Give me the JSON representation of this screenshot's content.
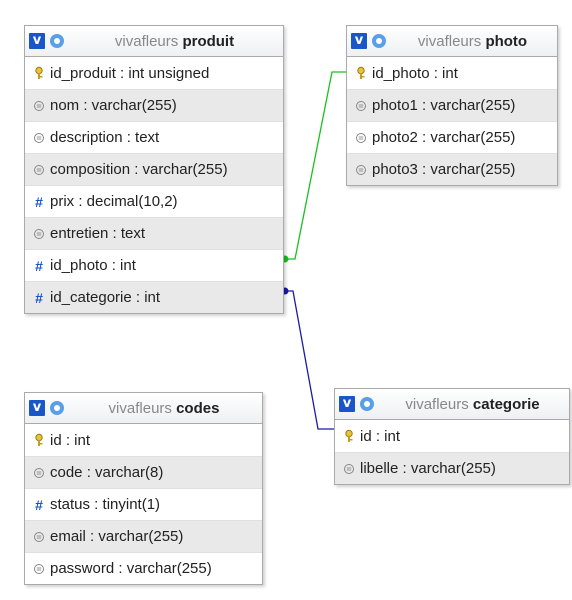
{
  "link_colors": {
    "photo": "#19c11f",
    "categorie": "#1a1aa8"
  },
  "icon_names": {
    "key": "key-icon",
    "text": "text-field-icon",
    "numeric": "hash-icon",
    "db": "v-icon",
    "options": "gear-icon"
  },
  "tables": {
    "produit": {
      "db_label": "vivafleurs",
      "name_label": "produit",
      "columns": [
        {
          "text": "id_produit : int unsigned",
          "icon": "key"
        },
        {
          "text": "nom : varchar(255)",
          "icon": "text"
        },
        {
          "text": "description : text",
          "icon": "text"
        },
        {
          "text": "composition : varchar(255)",
          "icon": "text"
        },
        {
          "text": "prix : decimal(10,2)",
          "icon": "numeric"
        },
        {
          "text": "entretien : text",
          "icon": "text"
        },
        {
          "text": "id_photo : int",
          "icon": "numeric"
        },
        {
          "text": "id_categorie : int",
          "icon": "numeric"
        }
      ]
    },
    "photo": {
      "db_label": "vivafleurs",
      "name_label": "photo",
      "columns": [
        {
          "text": "id_photo : int",
          "icon": "key"
        },
        {
          "text": "photo1 : varchar(255)",
          "icon": "text"
        },
        {
          "text": "photo2 : varchar(255)",
          "icon": "text"
        },
        {
          "text": "photo3 : varchar(255)",
          "icon": "text"
        }
      ]
    },
    "codes": {
      "db_label": "vivafleurs",
      "name_label": "codes",
      "columns": [
        {
          "text": "id : int",
          "icon": "key"
        },
        {
          "text": "code : varchar(8)",
          "icon": "text"
        },
        {
          "text": "status : tinyint(1)",
          "icon": "numeric"
        },
        {
          "text": "email : varchar(255)",
          "icon": "text"
        },
        {
          "text": "password : varchar(255)",
          "icon": "text"
        }
      ]
    },
    "categorie": {
      "db_label": "vivafleurs",
      "name_label": "categorie",
      "columns": [
        {
          "text": "id : int",
          "icon": "key"
        },
        {
          "text": "libelle : varchar(255)",
          "icon": "text"
        }
      ]
    }
  }
}
